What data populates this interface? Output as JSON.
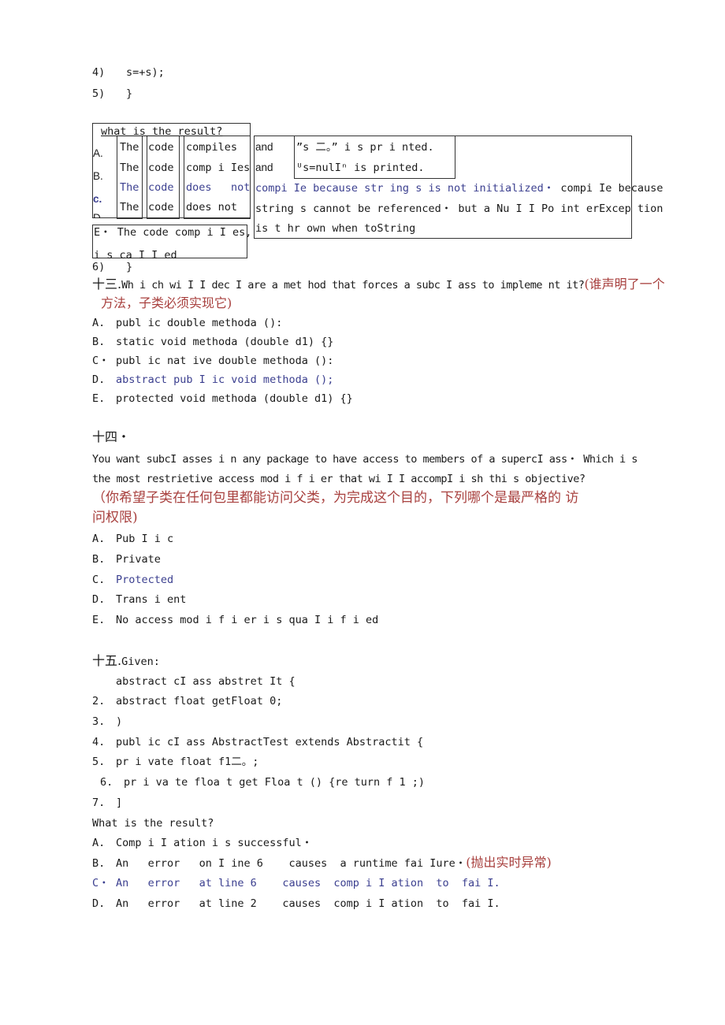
{
  "code_tail_top": [
    {
      "num": "4)",
      "text": "s=+s);"
    },
    {
      "num": "5)",
      "text": "}"
    }
  ],
  "q12_table": {
    "question": "what is the result?",
    "option_letters": [
      "A.",
      "B.",
      "c.",
      "D"
    ],
    "col_the": [
      "The",
      "The",
      "The",
      "The"
    ],
    "col_code": [
      "code",
      "code",
      "code",
      "code"
    ],
    "col_verb": [
      "compiles",
      "comp i Ies",
      "does",
      "does not"
    ],
    "col_verb_not": "not",
    "col_and": [
      "and",
      "and"
    ],
    "printed_lines": [
      "”s 二。”   i s pr i nted.",
      "ᵁs=nulIⁿ is printed."
    ],
    "option_c_rest": "compi Ie because str ing s is not initialized・",
    "option_d_rest_1": " compi Ie because",
    "option_d_rest_2": "string s cannot be referenced・  but a Nu I I Po int erExcep tion",
    "option_d_rest_3": "is t hr own when toString",
    "option_e_1": "E・  The code comp i I es,",
    "option_e_2": "i s ca I I ed"
  },
  "code_tail_bottom": {
    "num": "6)",
    "text": "}"
  },
  "q13": {
    "prefix": "十三.",
    "question": "Wh i ch wi I I dec I are a met hod that forces a subc I ass to impleme nt it?",
    "translation_1": "(谁声明了一个",
    "translation_2": "方法，子类必须实现它)",
    "options": [
      {
        "label": "A.",
        "text": "publ ic double methoda ():",
        "correct": false
      },
      {
        "label": "B.",
        "text": "static void methoda (double d1) {}",
        "correct": false
      },
      {
        "label": "C・",
        "text": "publ ic nat ive double methoda ():",
        "correct": false
      },
      {
        "label": "D.",
        "text": "abstract pub I ic void methoda ();",
        "correct": true
      },
      {
        "label": "E.",
        "text": "protected void methoda (double d1) {}",
        "correct": false
      }
    ]
  },
  "q14": {
    "prefix": "十四・",
    "question_1": "You want subcI asses i n any package to have access to members of a supercI ass・  Which i s",
    "question_2": "the most restrietive access mod i f i er that wi I I accompI i sh thi s objective?",
    "translation_1": "（你希望子类在任何包里都能访问父类，为完成这个目的，下列哪个是最严格的 访",
    "translation_2": "问权限)",
    "options": [
      {
        "label": "A.",
        "text": "Pub I i c",
        "correct": false
      },
      {
        "label": "B.",
        "text": "Private",
        "correct": false
      },
      {
        "label": "C.",
        "text": "Protected",
        "correct": true
      },
      {
        "label": "D.",
        "text": "Trans i ent",
        "correct": false
      },
      {
        "label": "E.",
        "text": "No access mod i f i er i s qua I i f i ed",
        "correct": false
      }
    ]
  },
  "q15": {
    "prefix": "十五.",
    "given": "Given:",
    "code": [
      {
        "num": "",
        "text": "abstract cI ass abstret It {"
      },
      {
        "num": "2.",
        "text": "abstract float getFloat 0;"
      },
      {
        "num": "3.",
        "text": ")"
      },
      {
        "num": "4.",
        "text": "publ ic cI ass AbstractTest extends Abstractit {"
      },
      {
        "num": "5.",
        "text": "pr i vate float f1二。;"
      },
      {
        "num": "6.",
        "text": "pr i va te floa t get Floa t () {re turn f 1 ;)"
      },
      {
        "num": "7.",
        "text": "]"
      }
    ],
    "result_question": "What is the result?",
    "options": [
      {
        "label": "A.",
        "text": "Comp i I ation i s successful・",
        "note": "",
        "correct": false
      },
      {
        "label": "B.",
        "text": "An   error   on I ine 6    causes  a runtime fai Iure・",
        "note": "(抛出实时异常)",
        "correct": false
      },
      {
        "label": "C・",
        "text": "An   error   at line 6    causes  comp i I ation  to  fai I.",
        "note": "",
        "correct": true
      },
      {
        "label": "D.",
        "text": "An   error   at line 2    causes  comp i I ation  to  fai I.",
        "note": "",
        "correct": false
      }
    ]
  },
  "colors": {
    "answer_blue": "#3b3f8f",
    "translation_red": "#a8403e",
    "text": "#1a1a1a"
  }
}
